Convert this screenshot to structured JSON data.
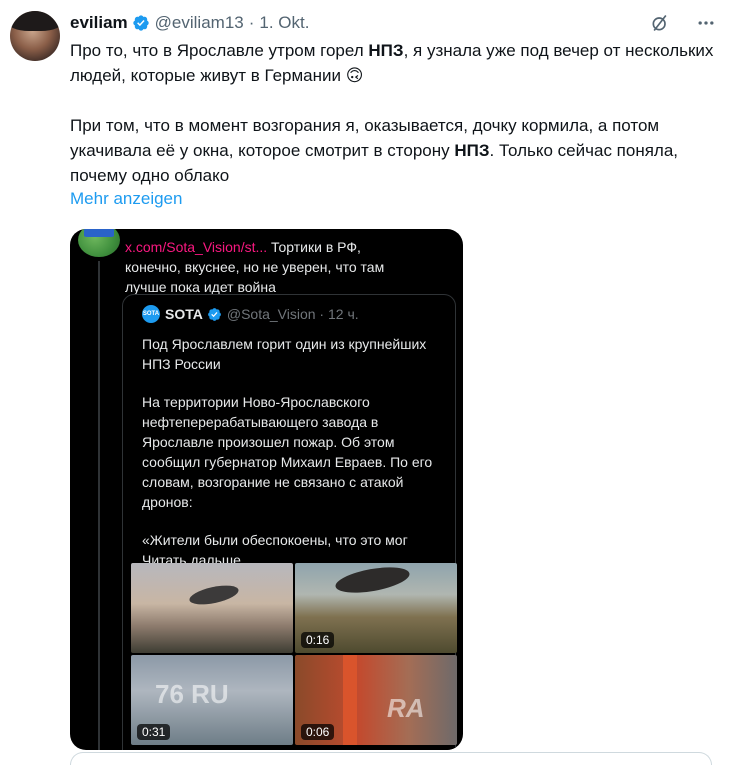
{
  "tweet": {
    "author_name": "eviliam",
    "handle": "@eviliam13",
    "separator": "·",
    "date": "1. Okt.",
    "text": {
      "p1_a": "Про то, что в Ярославле утром горел ",
      "p1_bold": "НПЗ",
      "p1_b": ", я узнала уже под вечер от нескольких людей, которые живут в Германии ",
      "p1_emoji": "🙃",
      "p2_a": "При том, что в момент возгорания я, оказывается, дочку кормила, а потом укачивала её у окна, которое смотрит в сторону ",
      "p2_bold": "НПЗ",
      "p2_b": ". Только сейчас поняла, почему одно облако"
    },
    "show_more_label": "Mehr anzeigen"
  },
  "media": {
    "quote_link": "x.com/Sota_Vision/st...",
    "quote_text": " Тортики в РФ, конечно, вкуснее, но не уверен, что там лучше пока идет война",
    "card": {
      "logo_text": "SOTA",
      "name": "SOTA",
      "handle_time": "@Sota_Vision · 12 ч.",
      "p1": "Под Ярославлем горит один из крупнейших НПЗ России",
      "p2": "На территории Ново-Ярославского нефтеперерабатывающего завода в Ярославле произошел пожар. Об этом сообщил губернатор Михаил Евраев. По его словам, возгорание не связано с атакой дронов:",
      "p3": "«Жители были обеспокоены, что это мог ",
      "read_more": "Читать дальше"
    },
    "thumbs": [
      {
        "duration": ""
      },
      {
        "duration": "0:16"
      },
      {
        "duration": "0:31",
        "watermark": "76 RU"
      },
      {
        "duration": "0:06",
        "watermark": "RA"
      }
    ]
  },
  "colors": {
    "verified_blue": "#1d9bf0",
    "link_blue": "#1d9bf0",
    "secondary_text": "#536471",
    "primary_text": "#0f1419"
  },
  "icons": [
    "verified-badge-icon",
    "grok-icon",
    "more-icon"
  ]
}
